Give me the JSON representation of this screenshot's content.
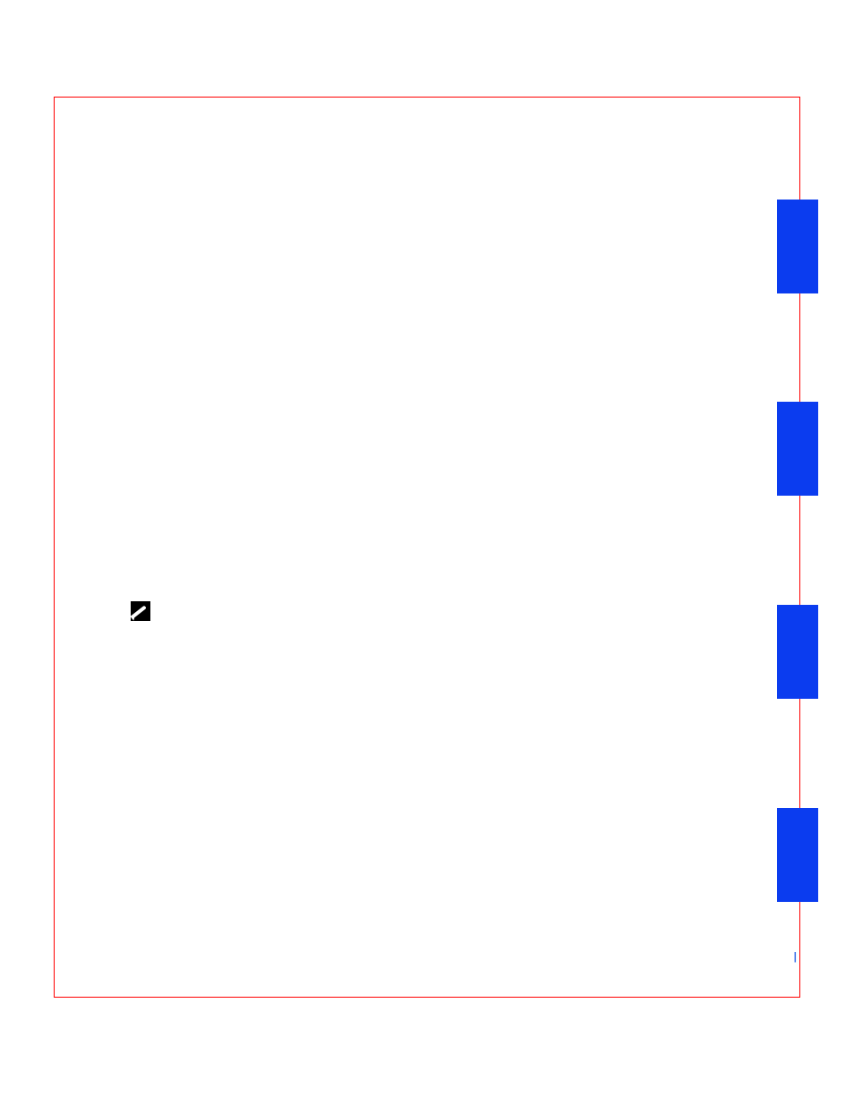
{
  "page": {
    "footer_separator": "|"
  }
}
